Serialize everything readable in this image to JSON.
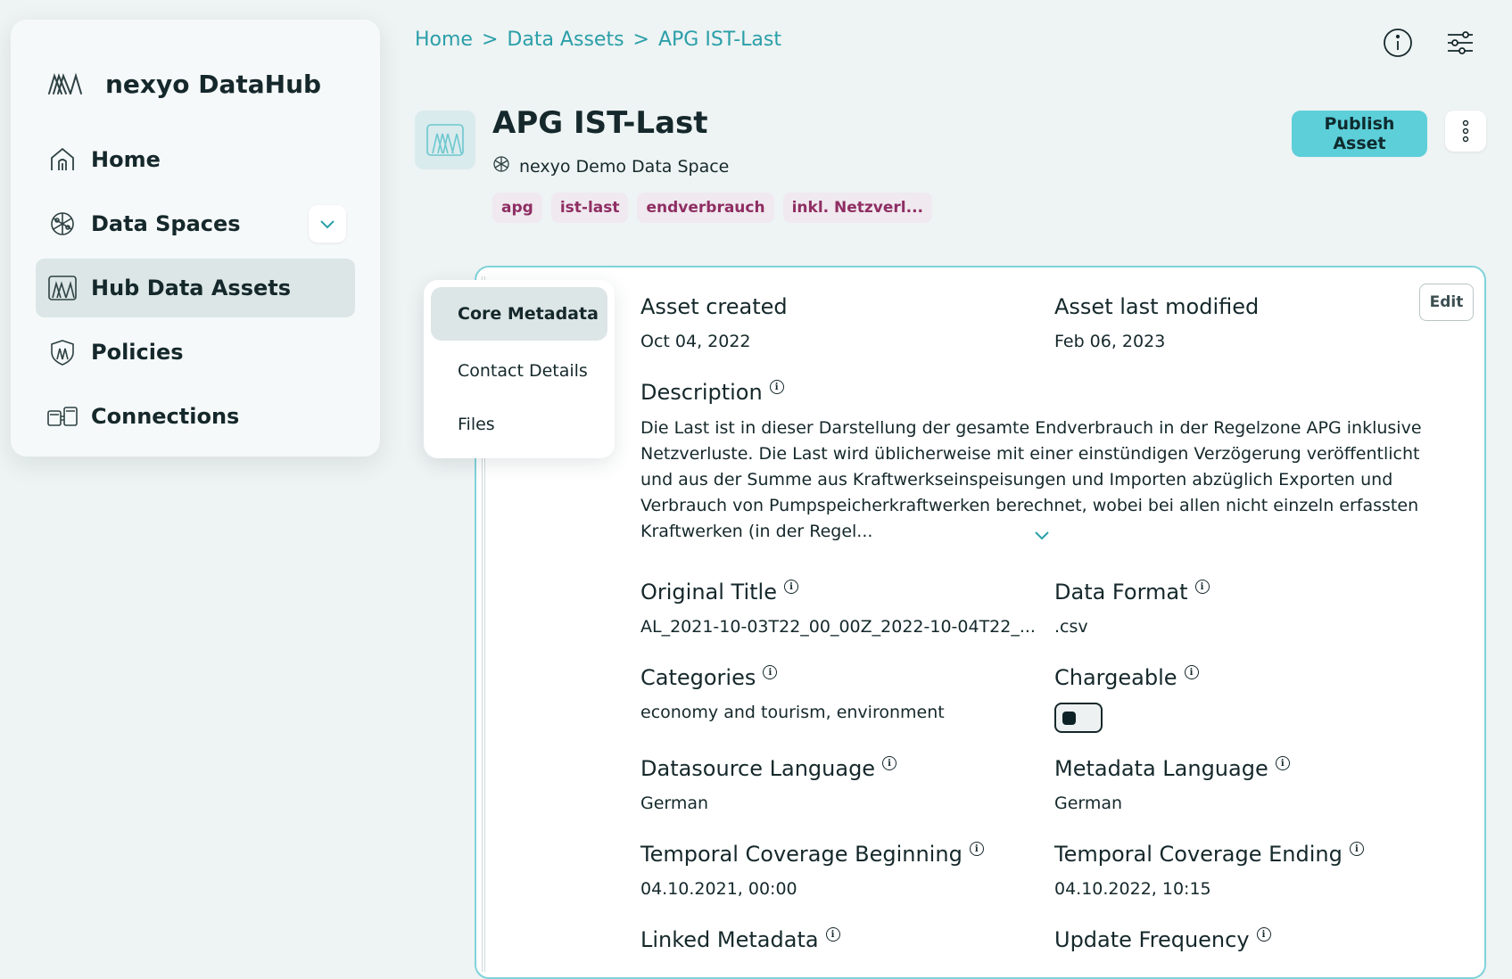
{
  "sidebar": {
    "brand": "nexyo DataHub",
    "items": [
      {
        "label": "Home"
      },
      {
        "label": "Data Spaces"
      },
      {
        "label": "Hub Data Assets"
      },
      {
        "label": "Policies"
      },
      {
        "label": "Connections"
      }
    ]
  },
  "breadcrumb": [
    "Home",
    "Data Assets",
    "APG IST-Last"
  ],
  "breadcrumb_sep": ">",
  "asset": {
    "title": "APG IST-Last",
    "space": "nexyo Demo Data Space",
    "tags": [
      "apg",
      "ist-last",
      "endverbrauch",
      "inkl. Netzverl..."
    ],
    "publish_label": "Publish Asset",
    "edit_label": "Edit"
  },
  "tabs": [
    "Core Metadata",
    "Contact Details",
    "Files"
  ],
  "fields": {
    "created": {
      "label": "Asset created",
      "value": "Oct 04, 2022"
    },
    "modified": {
      "label": "Asset last modified",
      "value": "Feb 06, 2023"
    },
    "description": {
      "label": "Description",
      "value": "Die Last ist in dieser Darstellung der gesamte Endverbrauch in der Regelzone APG inklusive Netzverluste. Die Last wird üblicherweise mit einer einstündigen Verzögerung veröffentlicht und aus der Summe aus Kraftwerkseinspeisungen und Importen abzüglich Exporten und Verbrauch von Pumpspeicherkraftwerken berechnet, wobei bei allen nicht einzeln erfassten Kraftwerken (in der Regel..."
    },
    "original_title": {
      "label": "Original Title",
      "value": "AL_2021-10-03T22_00_00Z_2022-10-04T22_..."
    },
    "data_format": {
      "label": "Data Format",
      "value": ".csv"
    },
    "categories": {
      "label": "Categories",
      "value": "economy and tourism, environment"
    },
    "chargeable": {
      "label": "Chargeable",
      "value": false
    },
    "datasource_language": {
      "label": "Datasource Language",
      "value": "German"
    },
    "metadata_language": {
      "label": "Metadata Language",
      "value": "German"
    },
    "temporal_begin": {
      "label": "Temporal Coverage Beginning",
      "value": "04.10.2021, 00:00"
    },
    "temporal_end": {
      "label": "Temporal Coverage Ending",
      "value": "04.10.2022, 10:15"
    },
    "linked_metadata": {
      "label": "Linked Metadata"
    },
    "update_frequency": {
      "label": "Update Frequency"
    }
  },
  "info_glyph": "i",
  "colors": {
    "accent": "#2a9fa9",
    "publish_bg": "#5ccfd9",
    "tag_text": "#8f2e63",
    "tag_bg": "#f0e9ef",
    "active_nav": "#dce6e6",
    "card_border": "#7fd3da"
  },
  "icons": {
    "brand": "nexyo-logo-icon",
    "home": "home-icon",
    "data_spaces": "globe-network-icon",
    "hub_assets": "data-asset-icon",
    "policies": "shield-icon",
    "connections": "connections-icon",
    "info": "info-icon",
    "settings": "sliders-icon",
    "more": "more-vertical-icon",
    "chevron": "chevron-down-icon"
  }
}
